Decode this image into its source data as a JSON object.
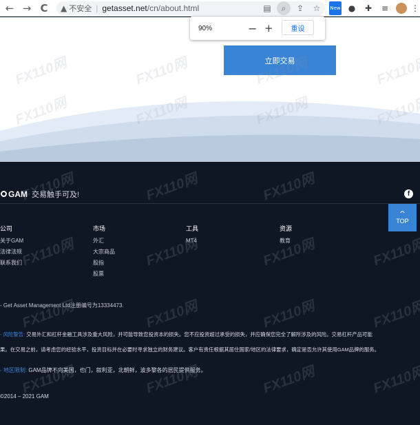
{
  "browser": {
    "back_icon": "←",
    "forward_icon": "→",
    "reload_icon": "C",
    "security_warning": "不安全",
    "url_domain": "getasset.net",
    "url_path": "/cn/about.html",
    "zoom_popup": {
      "percent": "90%",
      "minus": "−",
      "plus": "+",
      "reset": "重设"
    }
  },
  "hero": {
    "trade_button": "立即交易"
  },
  "footer": {
    "logo": "GAM",
    "slogan": "交易触手可及!",
    "facebook_icon": "f",
    "top_button": "TOP",
    "columns": [
      {
        "title": "公司",
        "items": [
          "关于GAM",
          "法律法规",
          "联系我们"
        ]
      },
      {
        "title": "市场",
        "items": [
          "外汇",
          "大宗商品",
          "股指",
          "股票"
        ]
      },
      {
        "title": "工具",
        "items": [
          "MT4"
        ]
      },
      {
        "title": "资源",
        "items": [
          "教育"
        ]
      }
    ],
    "registration": "- Get Asset Management Ltd注册编号为13334473.",
    "risk_tag": "- 风险警告:",
    "risk_line1": "交易外汇和杠杆金融工具涉及重大风险，并可能导致您投资本的损失。您不应投资超过承受的损失，并应确保您完全了解所涉及的风险。交易杠杆产品可能",
    "risk_line2": "果。在交易之前，请考虑您的经验水平，投资目标并在必要时寻求独立的财务建议。客户有责任根据其居住国家/地区的法律要求，确定是否允许其使用GAM品牌的服务。",
    "region_tag": "- 地区限制:",
    "region_text": "GAM品牌不向美国，也门，叙利亚，北朝鲜，波多黎各的居民提供服务。",
    "copyright": "©2014 – 2021 GAM"
  },
  "watermark": "FX110网"
}
